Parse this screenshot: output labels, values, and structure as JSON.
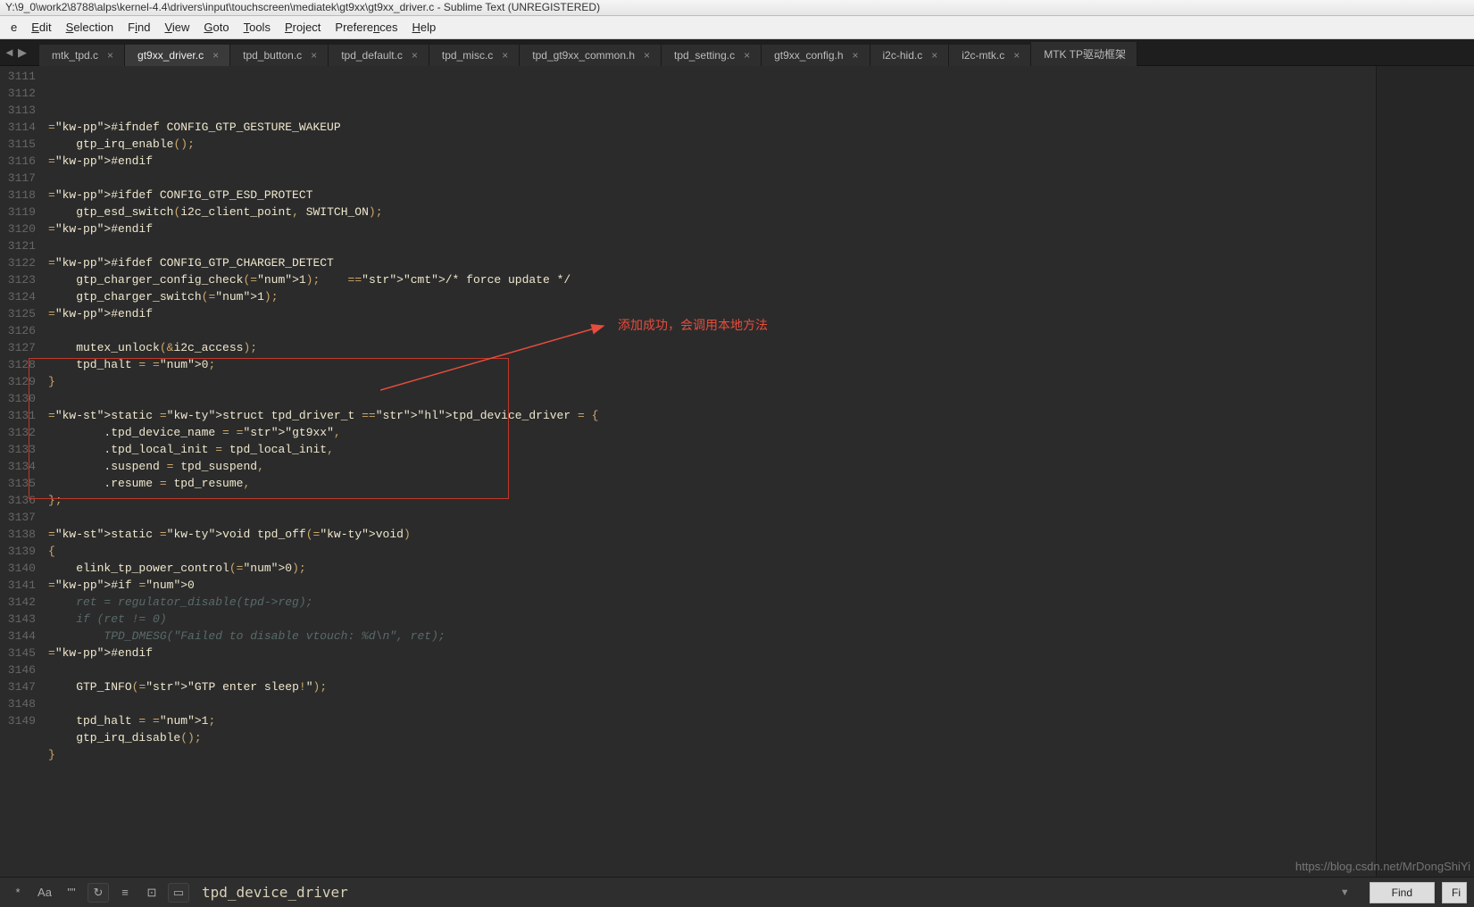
{
  "window": {
    "title": "Y:\\9_0\\work2\\8788\\alps\\kernel-4.4\\drivers\\input\\touchscreen\\mediatek\\gt9xx\\gt9xx_driver.c - Sublime Text (UNREGISTERED)"
  },
  "menu": [
    "e",
    "Edit",
    "Selection",
    "Find",
    "View",
    "Goto",
    "Tools",
    "Project",
    "Preferences",
    "Help"
  ],
  "tabs": [
    {
      "label": "mtk_tpd.c",
      "active": false
    },
    {
      "label": "gt9xx_driver.c",
      "active": true
    },
    {
      "label": "tpd_button.c",
      "active": false
    },
    {
      "label": "tpd_default.c",
      "active": false
    },
    {
      "label": "tpd_misc.c",
      "active": false
    },
    {
      "label": "tpd_gt9xx_common.h",
      "active": false
    },
    {
      "label": "tpd_setting.c",
      "active": false
    },
    {
      "label": "gt9xx_config.h",
      "active": false
    },
    {
      "label": "i2c-hid.c",
      "active": false
    },
    {
      "label": "i2c-mtk.c",
      "active": false
    },
    {
      "label": "MTK TP驱动框架",
      "active": false,
      "noclose": true
    }
  ],
  "gutter_start": 3111,
  "gutter_end": 3149,
  "code": {
    "3111": "",
    "3112": "#ifndef CONFIG_GTP_GESTURE_WAKEUP",
    "3113": "    gtp_irq_enable();",
    "3114": "#endif",
    "3115": "",
    "3116": "#ifdef CONFIG_GTP_ESD_PROTECT",
    "3117": "    gtp_esd_switch(i2c_client_point, SWITCH_ON);",
    "3118": "#endif",
    "3119": "",
    "3120": "#ifdef CONFIG_GTP_CHARGER_DETECT",
    "3121": "    gtp_charger_config_check(1);    /* force update */",
    "3122": "    gtp_charger_switch(1);",
    "3123": "#endif",
    "3124": "",
    "3125": "    mutex_unlock(&i2c_access);",
    "3126": "    tpd_halt = 0;",
    "3127": "}",
    "3128": "",
    "3129": "static struct tpd_driver_t tpd_device_driver = {",
    "3130": "        .tpd_device_name = \"gt9xx\",",
    "3131": "        .tpd_local_init = tpd_local_init,",
    "3132": "        .suspend = tpd_suspend,",
    "3133": "        .resume = tpd_resume,",
    "3134": "};",
    "3135": "",
    "3136": "static void tpd_off(void)",
    "3137": "{",
    "3138": "    elink_tp_power_control(0);",
    "3139": "#if 0",
    "3140": "    ret = regulator_disable(tpd->reg);",
    "3141": "    if (ret != 0)",
    "3142": "        TPD_DMESG(\"Failed to disable vtouch: %d\\n\", ret);",
    "3143": "#endif",
    "3144": "",
    "3145": "    GTP_INFO(\"GTP enter sleep!\");",
    "3146": "",
    "3147": "    tpd_halt = 1;",
    "3148": "    gtp_irq_disable();",
    "3149": "}"
  },
  "annotation": {
    "text": "添加成功，会调用本地方法",
    "highlight": "tpd_device_driver"
  },
  "find": {
    "icons": [
      "*",
      "Aa",
      "\"\"",
      "↻",
      "≡",
      "⊡",
      "▭"
    ],
    "value": "tpd_device_driver",
    "button": "Find",
    "button2": "Fi"
  },
  "watermark": "https://blog.csdn.net/MrDongShiYi"
}
